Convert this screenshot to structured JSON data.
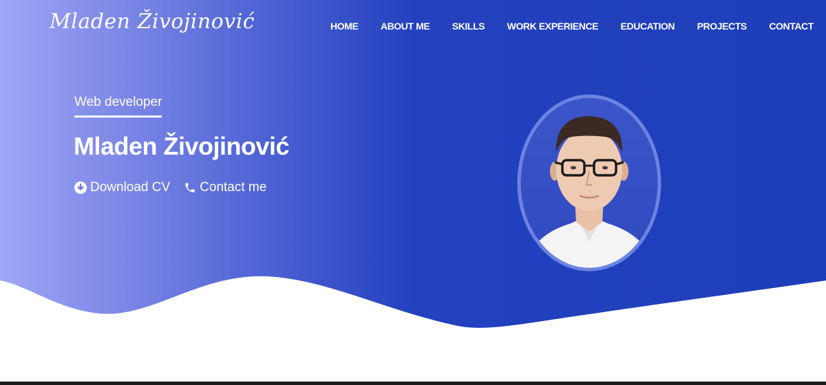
{
  "brand": {
    "name": "Mladen Živojinović"
  },
  "nav": {
    "items": [
      "HOME",
      "ABOUT ME",
      "SKILLS",
      "WORK EXPERIENCE",
      "EDUCATION",
      "PROJECTS",
      "CONTACT"
    ]
  },
  "hero": {
    "subtitle": "Web developer",
    "name": "Mladen Živojinović",
    "download_label": "Download CV",
    "download_icon": "download-circle-icon",
    "contact_label": "Contact me",
    "contact_icon": "phone-icon"
  },
  "colors": {
    "hero_start": "#9fa6f5",
    "hero_end": "#1e3eb9",
    "text": "#ffffff",
    "portrait_ring": "#6a82e0"
  }
}
